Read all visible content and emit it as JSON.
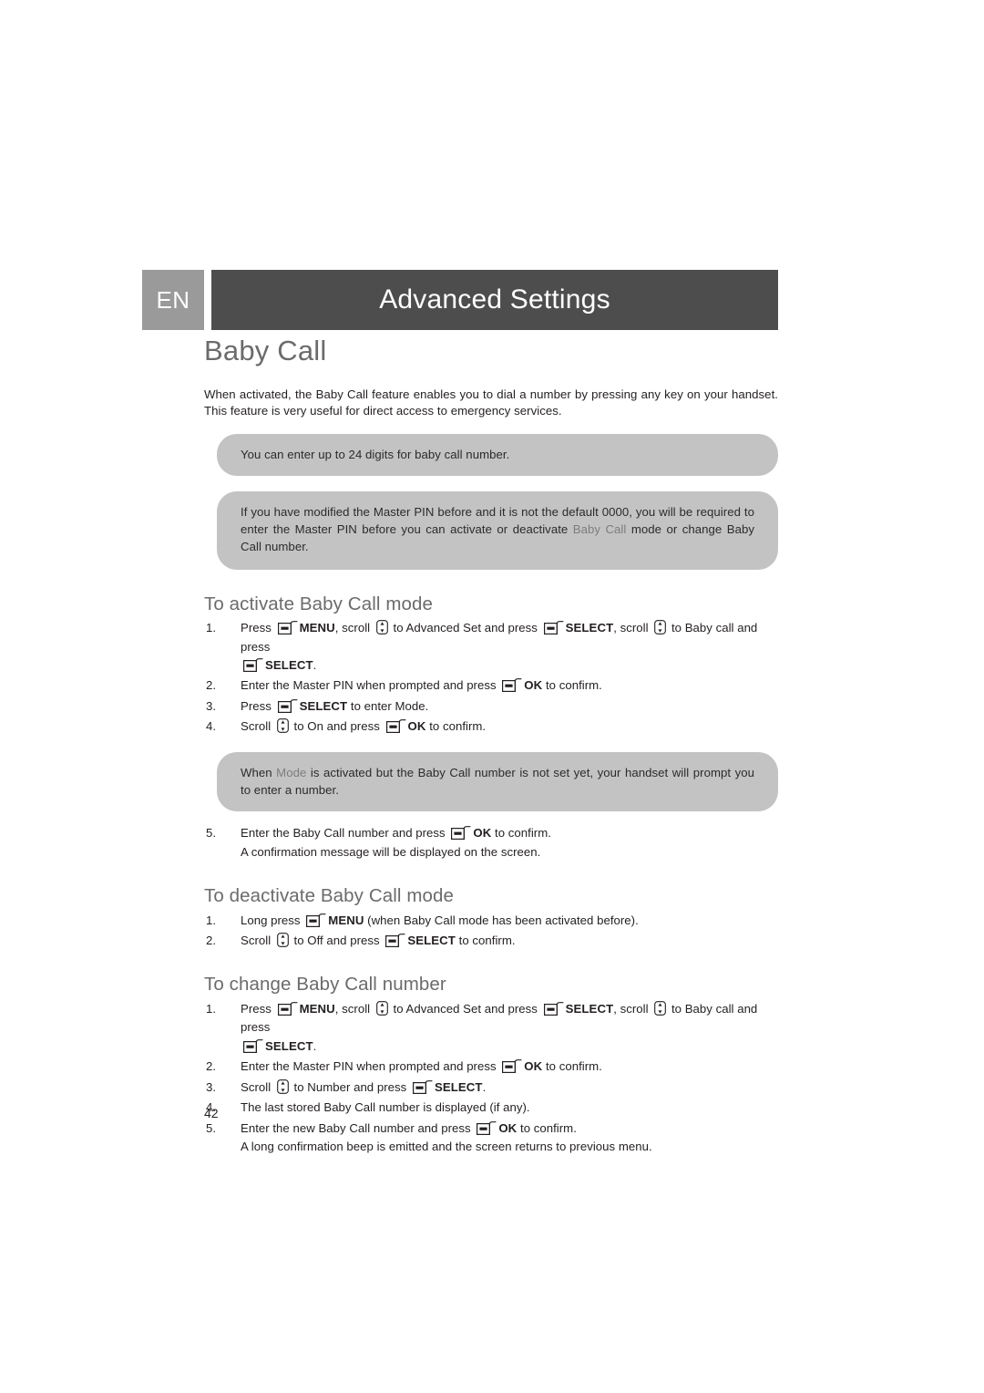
{
  "header": {
    "language_badge": "EN",
    "banner_title": "Advanced Settings",
    "banner_color": "#4d4d4d",
    "badge_color": "#9a9a9a"
  },
  "doc": {
    "title": "Baby Call",
    "intro": "When activated, the Baby Call feature enables you to dial a number by pressing any key on your handset. This feature is very useful for direct access to emergency services.",
    "page_number": "42",
    "title_color": "#6b6b6b",
    "note_background": "#c3c3c3"
  },
  "notes": {
    "digits_note": "You can enter up to 24 digits for baby call number.",
    "pin_note": {
      "part1": "If you have modified the Master PIN before and it is not the default 0000, you will be required to enter the Master PIN before you can activate or deactivate ",
      "highlight": "Baby Call",
      "part2": " mode or change Baby Call number."
    },
    "mode_note": {
      "part1": "When ",
      "highlight": "Mode",
      "part2": " is activated but the Baby Call number is not set yet, your handset will prompt you to enter a number."
    }
  },
  "sections": [
    {
      "heading": "To activate Baby Call mode",
      "steps": [
        {
          "num": "1.",
          "seg": [
            "Press ",
            "MENU",
            ", scroll ",
            " to Advanced Set and press ",
            "SELECT",
            ", scroll ",
            " to Baby call and press "
          ],
          "sub_key": "SELECT",
          "sub_tail": "."
        },
        {
          "num": "2.",
          "text_before": "Enter the Master PIN when prompted and press ",
          "key": "OK",
          "text_after": " to confirm."
        },
        {
          "num": "3.",
          "text_before": "Press ",
          "key": "SELECT",
          "text_after": " to enter Mode."
        },
        {
          "num": "4.",
          "text_before": "Scroll ",
          "text_mid": " to On and press ",
          "key": "OK",
          "text_after": " to confirm."
        }
      ]
    },
    {
      "heading": "To deactivate Baby Call mode",
      "steps": [
        {
          "num": "1.",
          "text_before": "Long press ",
          "key": "MENU",
          "text_after": " (when Baby Call mode has been activated before)."
        },
        {
          "num": "2.",
          "text_before": "Scroll ",
          "text_mid": " to Off and press ",
          "key": "SELECT",
          "text_after": " to confirm."
        }
      ]
    },
    {
      "heading": "To change Baby Call number",
      "steps": [
        {
          "num": "1.",
          "seg": [
            "Press ",
            "MENU",
            ", scroll ",
            " to Advanced Set and press ",
            "SELECT",
            ", scroll ",
            " to Baby call and press "
          ],
          "sub_key": "SELECT",
          "sub_tail": "."
        },
        {
          "num": "2.",
          "text_before": "Enter the Master PIN when prompted and press ",
          "key": "OK",
          "text_after": " to confirm."
        },
        {
          "num": "3.",
          "text_before": "Scroll ",
          "text_mid": " to Number and press ",
          "key": "SELECT",
          "text_after": "."
        },
        {
          "num": "4.",
          "text_plain": "The last stored Baby Call number is displayed (if any)."
        },
        {
          "num": "5.",
          "text_before": "Enter the new Baby Call number and press ",
          "key": "OK",
          "text_after": " to confirm.",
          "sub_line": "A long confirmation beep is emitted and the screen returns to previous menu."
        }
      ]
    }
  ],
  "step5_activate": {
    "num": "5.",
    "text_before": "Enter the Baby Call number and press ",
    "key": "OK",
    "text_after": " to confirm.",
    "sub_line": "A confirmation message will be displayed on the screen."
  },
  "icons": {
    "softkey": "softkey-icon",
    "scroll": "scroll-updown-icon"
  }
}
